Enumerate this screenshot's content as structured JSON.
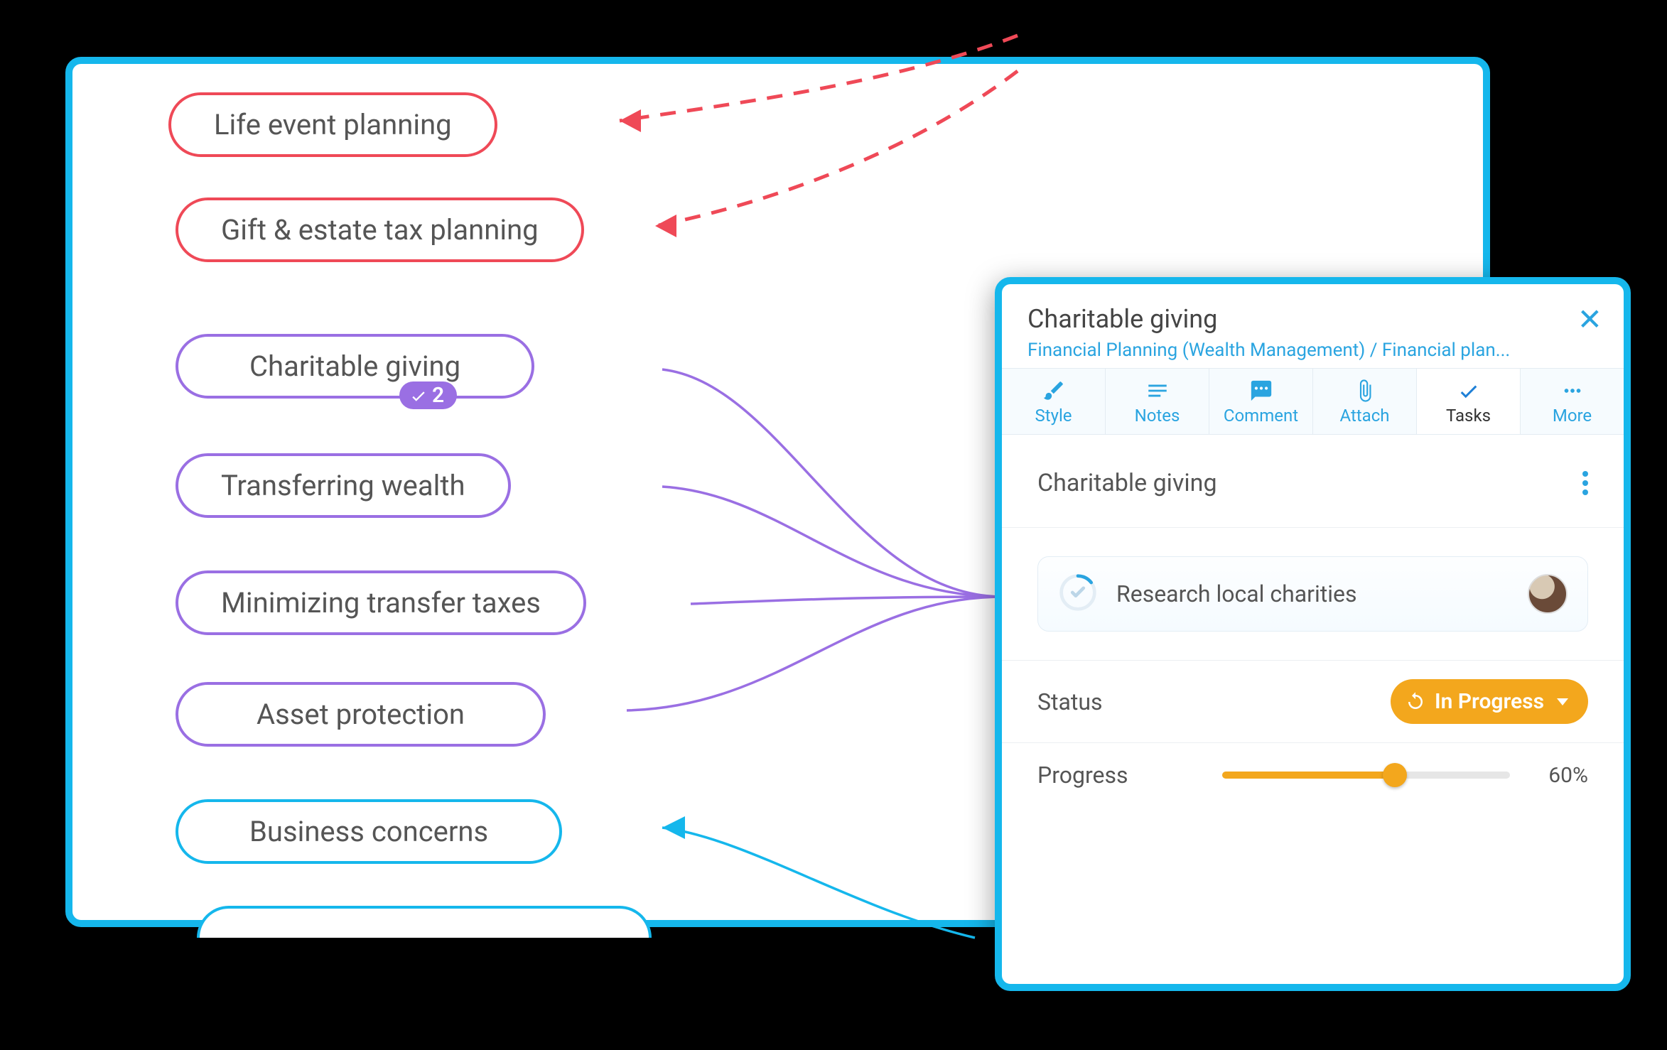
{
  "canvas": {
    "nodes": {
      "life_event": {
        "label": "Life event planning",
        "color": "red"
      },
      "gift_estate": {
        "label": "Gift & estate tax planning",
        "color": "red"
      },
      "charitable": {
        "label": "Charitable giving",
        "color": "purple",
        "task_count": "2"
      },
      "transfer_wealth": {
        "label": "Transferring wealth",
        "color": "purple"
      },
      "min_transfer_tax": {
        "label": "Minimizing transfer taxes",
        "color": "purple"
      },
      "asset_protection": {
        "label": "Asset protection",
        "color": "purple"
      },
      "business": {
        "label": "Business concerns",
        "color": "blue"
      }
    }
  },
  "panel": {
    "title": "Charitable giving",
    "breadcrumb": "Financial Planning (Wealth Management) / Financial plan...",
    "tabs": {
      "style": "Style",
      "notes": "Notes",
      "comment": "Comment",
      "attach": "Attach",
      "tasks": "Tasks",
      "more": "More"
    },
    "task_group_name": "Charitable giving",
    "subtask": {
      "name": "Research local charities"
    },
    "status": {
      "label": "Status",
      "value": "In Progress"
    },
    "progress": {
      "label": "Progress",
      "percent": 60,
      "display": "60%"
    }
  },
  "colors": {
    "border_red": "#ef4957",
    "border_purple": "#9a6fe3",
    "border_blue": "#15b7ec",
    "accent_gold": "#f3a71d",
    "accent_sky": "#2aa4e0"
  }
}
